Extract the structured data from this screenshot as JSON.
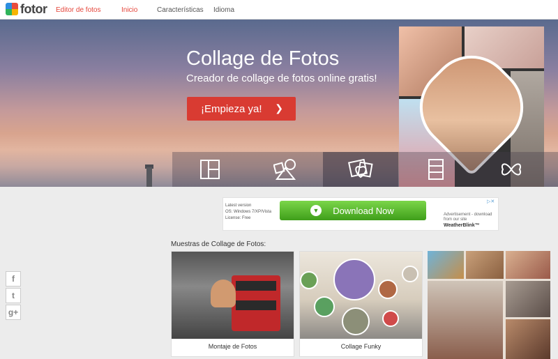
{
  "header": {
    "logo_text": "fotor",
    "subtitle": "Editor de fotos",
    "nav": [
      {
        "label": "Inicio",
        "active": true
      },
      {
        "label": "Características",
        "active": false
      },
      {
        "label": "Idioma",
        "active": false
      }
    ]
  },
  "hero": {
    "title": "Collage de Fotos",
    "subtitle": "Creador de collage de fotos online gratis!",
    "cta_label": "¡Empieza ya!",
    "layout_buttons": [
      {
        "icon": "grid-layout-icon",
        "active": false
      },
      {
        "icon": "shapes-layout-icon",
        "active": false
      },
      {
        "icon": "hearts-layout-icon",
        "active": true
      },
      {
        "icon": "stacked-layout-icon",
        "active": false
      },
      {
        "icon": "butterfly-layout-icon",
        "active": false
      }
    ]
  },
  "ad": {
    "info_lines": [
      "Latest version",
      "OS: Windows 7/XP/Vista",
      "License: Free"
    ],
    "button_label": "Download Now",
    "right_text": "Advertisement - download from our site",
    "brand": "WeatherBlink™",
    "close_label": "▷✕"
  },
  "samples": {
    "heading": "Muestras de Collage de Fotos:",
    "cards": [
      {
        "caption": "Montaje de Fotos"
      },
      {
        "caption": "Collage Funky"
      }
    ]
  },
  "social": [
    {
      "icon": "facebook-icon",
      "glyph": "f"
    },
    {
      "icon": "twitter-icon",
      "glyph": "t"
    },
    {
      "icon": "google-plus-icon",
      "glyph": "g+"
    }
  ],
  "colors": {
    "accent": "#e5453a",
    "cta": "#d93b32",
    "download_green": "#4aa822"
  }
}
